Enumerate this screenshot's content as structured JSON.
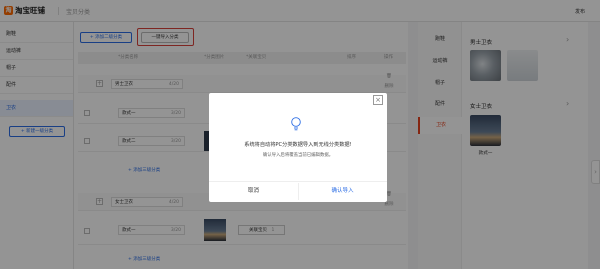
{
  "header": {
    "logo_text": "淘宝旺铺",
    "page_title": "宝贝分类",
    "publish": "发布"
  },
  "sidebar": {
    "items": [
      {
        "label": "跑鞋"
      },
      {
        "label": "运动裤"
      },
      {
        "label": "帽子"
      },
      {
        "label": "配件"
      },
      {
        "label": "卫衣"
      }
    ],
    "active_index": 4,
    "add_button": "+ 新建一级分类"
  },
  "toolbar": {
    "add_secondary": "+ 添加二级分类",
    "import": "一键导入分类"
  },
  "table": {
    "headers": {
      "name": "*分类名称",
      "image": "*分类图片",
      "products": "*关联宝贝",
      "sort": "排序",
      "ops": "操作"
    },
    "groups": [
      {
        "name": "男士卫衣",
        "count": "4/20",
        "children": [
          {
            "name": "款式一",
            "count": "3/20"
          },
          {
            "name": "款式二",
            "count": "3/20"
          }
        ],
        "add_tertiary": "+ 添加三级分类"
      },
      {
        "name": "女士卫衣",
        "count": "4/20",
        "children": [
          {
            "name": "款式一",
            "count": "3/20",
            "add_product": "关联宝贝",
            "product_count": "1"
          }
        ],
        "add_tertiary": "+ 添加三级分类"
      }
    ],
    "ops_label": "删除"
  },
  "modal": {
    "title": "系统将自动将PC分类数据导入到无线分类数据!",
    "subtitle": "确认导入后将覆盖当前已编辑数据。",
    "cancel": "取消",
    "confirm": "确认导入",
    "close_icon": "close-icon",
    "illustration_icon": "lightbulb-icon",
    "accent_color": "#2b6de5"
  },
  "preview": {
    "nav": [
      {
        "label": "跑鞋"
      },
      {
        "label": "运动裤"
      },
      {
        "label": "帽子"
      },
      {
        "label": "配件"
      },
      {
        "label": "卫衣"
      }
    ],
    "active_index": 4,
    "sections": [
      {
        "title": "男士卫衣",
        "items": [
          {
            "label": ""
          },
          {
            "label": ""
          }
        ]
      },
      {
        "title": "女士卫衣",
        "items": [
          {
            "label": "款式一"
          }
        ]
      }
    ],
    "active_color": "#e5421f"
  }
}
